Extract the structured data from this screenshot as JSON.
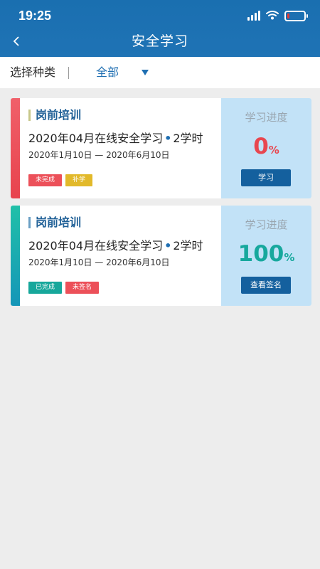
{
  "status_bar": {
    "time": "19:25",
    "battery_level": 0.15
  },
  "header": {
    "back_icon": "chevron-left-icon",
    "title": "安全学习"
  },
  "filter": {
    "label": "选择种类",
    "value": "全部",
    "arrow_icon": "triangle-down-icon"
  },
  "courses": [
    {
      "type": "岗前培训",
      "title": "2020年04月在线安全学习",
      "dot": "•",
      "hours": "2学时",
      "dates": "2020年1月10日 — 2020年6月10日",
      "tags": [
        "未完成",
        "补学"
      ],
      "progress_label": "学习进度",
      "progress_value": "0",
      "progress_unit": "%",
      "action": "学习",
      "accent": "#e8464f"
    },
    {
      "type": "岗前培训",
      "title": "2020年04月在线安全学习",
      "dot": "•",
      "hours": "2学时",
      "dates": "2020年1月10日 — 2020年6月10日",
      "tags": [
        "已完成",
        "未签名"
      ],
      "progress_label": "学习进度",
      "progress_value": "100",
      "progress_unit": "%",
      "action": "查看签名",
      "accent": "#17a89d"
    }
  ],
  "colors": {
    "header": "#1a6fb0",
    "primary": "#1f6fb2",
    "progress_panel": "#c2e2f7",
    "button": "#14609e"
  }
}
